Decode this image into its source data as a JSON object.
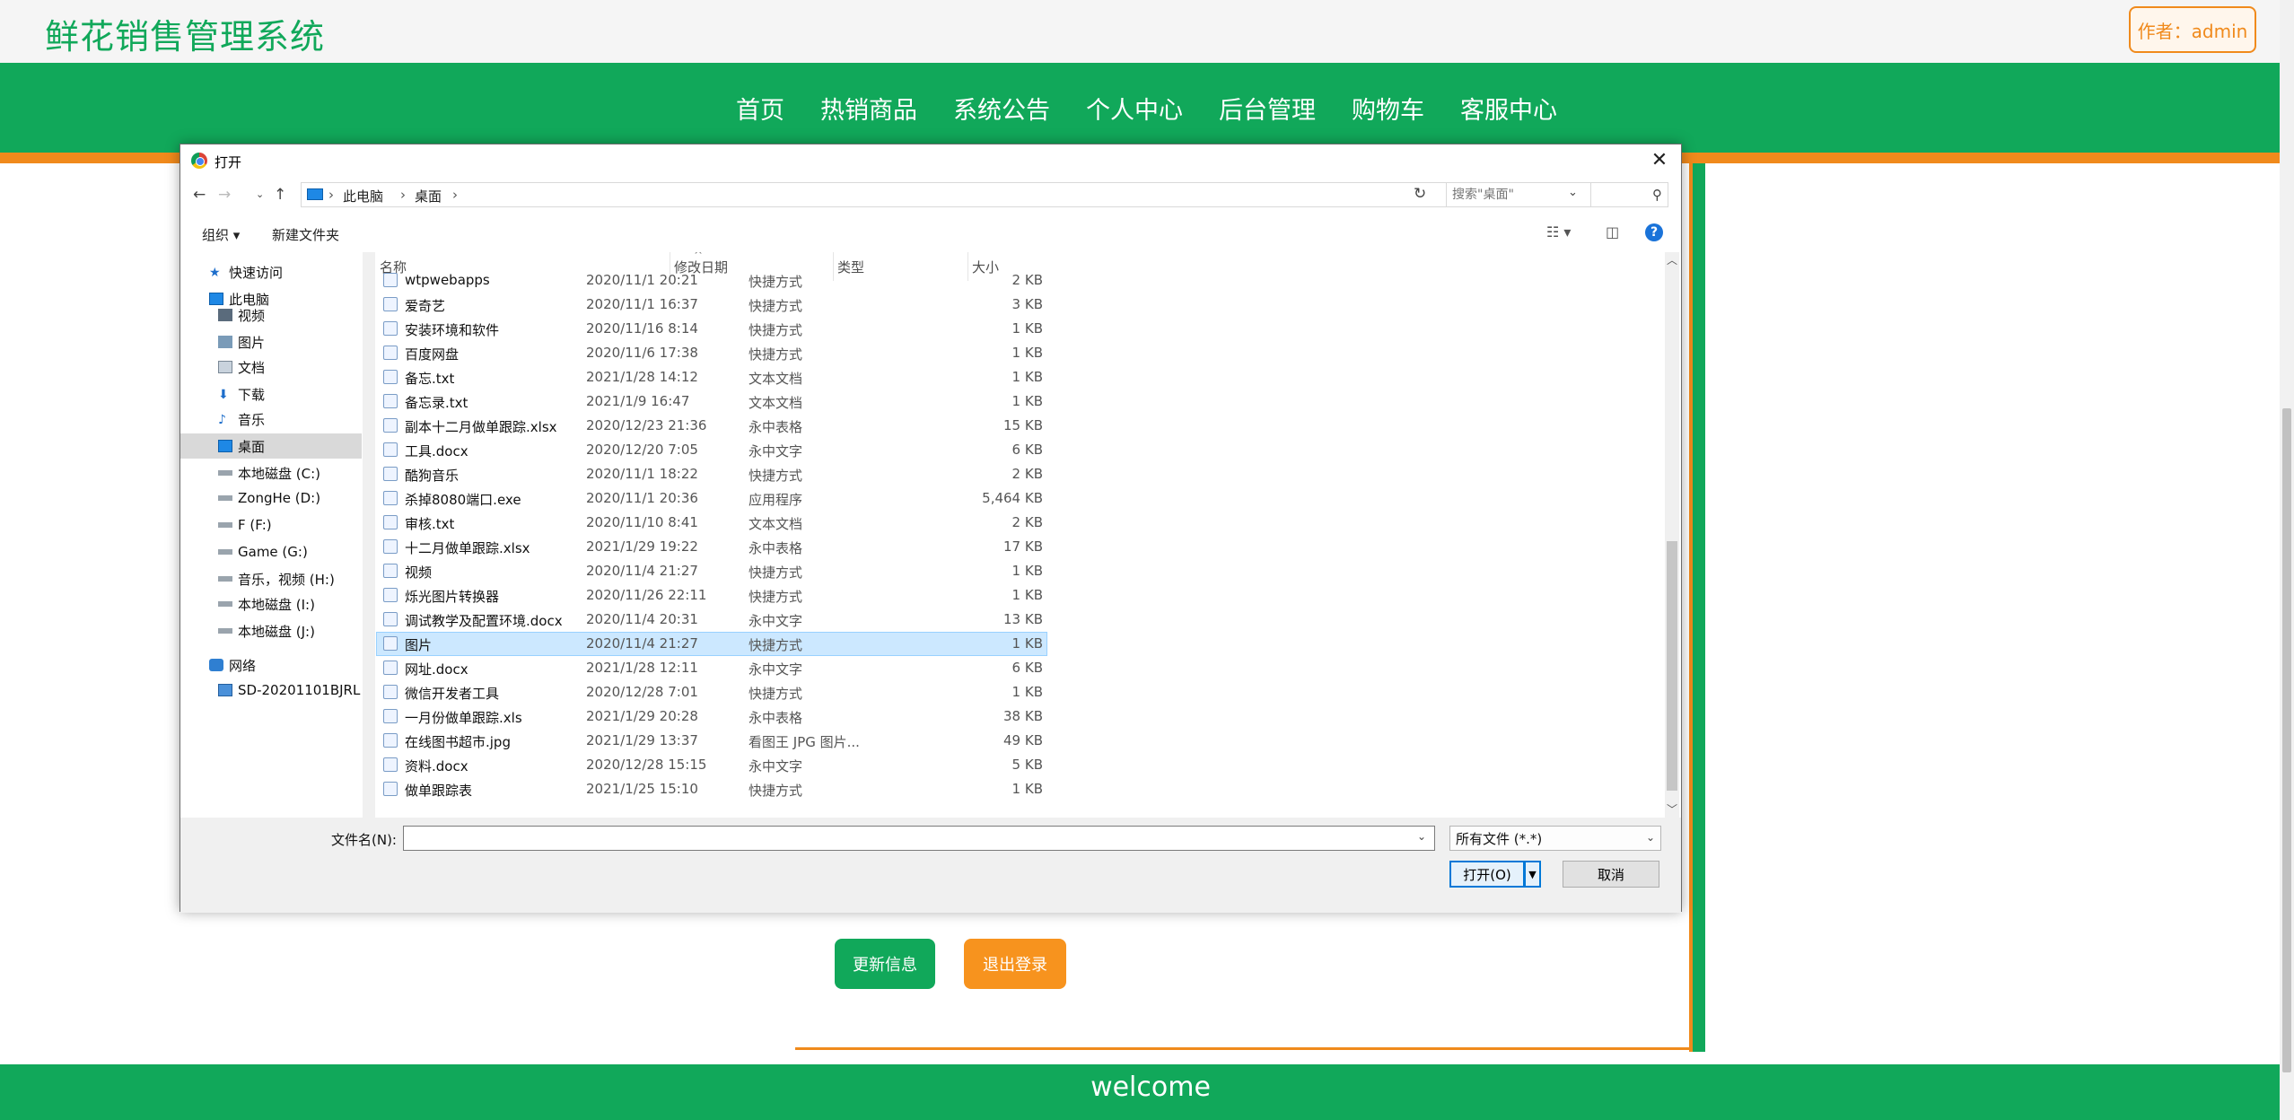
{
  "site": {
    "title": "鲜花销售管理系统",
    "author": "作者：admin",
    "nav": [
      "首页",
      "热销商品",
      "系统公告",
      "个人中心",
      "后台管理",
      "购物车",
      "客服中心"
    ],
    "buttons": {
      "update": "更新信息",
      "logout": "退出登录"
    },
    "footer": "welcome",
    "colors": {
      "primary": "#11a85a",
      "accent": "#f08a1c"
    }
  },
  "dialog": {
    "title": "打开",
    "breadcrumbs": [
      "此电脑",
      "桌面"
    ],
    "search_placeholder": "搜索\"桌面\"",
    "toolbar": {
      "organize": "组织 ▾",
      "new_folder": "新建文件夹"
    },
    "tree": [
      {
        "label": "快速访问",
        "icon": "star-icon",
        "indent": 1
      },
      {
        "label": "此电脑",
        "icon": "pc-icon",
        "indent": 1
      },
      {
        "label": "视频",
        "icon": "video-folder-icon",
        "indent": 2
      },
      {
        "label": "图片",
        "icon": "picture-folder-icon",
        "indent": 2
      },
      {
        "label": "文档",
        "icon": "document-folder-icon",
        "indent": 2
      },
      {
        "label": "下载",
        "icon": "download-icon",
        "indent": 2
      },
      {
        "label": "音乐",
        "icon": "music-icon",
        "indent": 2
      },
      {
        "label": "桌面",
        "icon": "desktop-icon",
        "indent": 2,
        "selected": true
      },
      {
        "label": "本地磁盘 (C:)",
        "icon": "drive-icon",
        "indent": 2
      },
      {
        "label": "ZongHe (D:)",
        "icon": "drive-icon",
        "indent": 2
      },
      {
        "label": "F (F:)",
        "icon": "drive-icon",
        "indent": 2
      },
      {
        "label": "Game (G:)",
        "icon": "drive-icon",
        "indent": 2
      },
      {
        "label": "音乐，视频 (H:)",
        "icon": "drive-icon",
        "indent": 2
      },
      {
        "label": "本地磁盘 (I:)",
        "icon": "drive-icon",
        "indent": 2
      },
      {
        "label": "本地磁盘 (J:)",
        "icon": "drive-icon",
        "indent": 2
      },
      {
        "label": "网络",
        "icon": "network-icon",
        "indent": 1
      },
      {
        "label": "SD-20201101BJRL",
        "icon": "computer-icon",
        "indent": 2
      }
    ],
    "columns": {
      "name": "名称",
      "date": "修改日期",
      "type": "类型",
      "size": "大小"
    },
    "files": [
      {
        "name": "wtpwebapps",
        "date": "2020/11/1 20:21",
        "type": "快捷方式",
        "size": "2 KB"
      },
      {
        "name": "爱奇艺",
        "date": "2020/11/1 16:37",
        "type": "快捷方式",
        "size": "3 KB"
      },
      {
        "name": "安装环境和软件",
        "date": "2020/11/16 8:14",
        "type": "快捷方式",
        "size": "1 KB"
      },
      {
        "name": "百度网盘",
        "date": "2020/11/6 17:38",
        "type": "快捷方式",
        "size": "1 KB"
      },
      {
        "name": "备忘.txt",
        "date": "2021/1/28 14:12",
        "type": "文本文档",
        "size": "1 KB"
      },
      {
        "name": "备忘录.txt",
        "date": "2021/1/9 16:47",
        "type": "文本文档",
        "size": "1 KB"
      },
      {
        "name": "副本十二月做单跟踪.xlsx",
        "date": "2020/12/23 21:36",
        "type": "永中表格",
        "size": "15 KB"
      },
      {
        "name": "工具.docx",
        "date": "2020/12/20 7:05",
        "type": "永中文字",
        "size": "6 KB"
      },
      {
        "name": "酷狗音乐",
        "date": "2020/11/1 18:22",
        "type": "快捷方式",
        "size": "2 KB"
      },
      {
        "name": "杀掉8080端口.exe",
        "date": "2020/11/1 20:36",
        "type": "应用程序",
        "size": "5,464 KB"
      },
      {
        "name": "审核.txt",
        "date": "2020/11/10 8:41",
        "type": "文本文档",
        "size": "2 KB"
      },
      {
        "name": "十二月做单跟踪.xlsx",
        "date": "2021/1/29 19:22",
        "type": "永中表格",
        "size": "17 KB"
      },
      {
        "name": "视频",
        "date": "2020/11/4 21:27",
        "type": "快捷方式",
        "size": "1 KB"
      },
      {
        "name": "烁光图片转换器",
        "date": "2020/11/26 22:11",
        "type": "快捷方式",
        "size": "1 KB"
      },
      {
        "name": "调试教学及配置环境.docx",
        "date": "2020/11/4 20:31",
        "type": "永中文字",
        "size": "13 KB"
      },
      {
        "name": "图片",
        "date": "2020/11/4 21:27",
        "type": "快捷方式",
        "size": "1 KB",
        "selected": true
      },
      {
        "name": "网址.docx",
        "date": "2021/1/28 12:11",
        "type": "永中文字",
        "size": "6 KB"
      },
      {
        "name": "微信开发者工具",
        "date": "2020/12/28 7:01",
        "type": "快捷方式",
        "size": "1 KB"
      },
      {
        "name": "一月份做单跟踪.xls",
        "date": "2021/1/29 20:28",
        "type": "永中表格",
        "size": "38 KB"
      },
      {
        "name": "在线图书超市.jpg",
        "date": "2021/1/29 13:37",
        "type": "看图王 JPG 图片...",
        "size": "49 KB"
      },
      {
        "name": "资料.docx",
        "date": "2020/12/28 15:15",
        "type": "永中文字",
        "size": "5 KB"
      },
      {
        "name": "做单跟踪表",
        "date": "2021/1/25 15:10",
        "type": "快捷方式",
        "size": "1 KB"
      }
    ],
    "filename_label": "文件名(N):",
    "filename_value": "",
    "filetype": "所有文件 (*.*)",
    "open_label": "打开(O)",
    "cancel_label": "取消"
  }
}
